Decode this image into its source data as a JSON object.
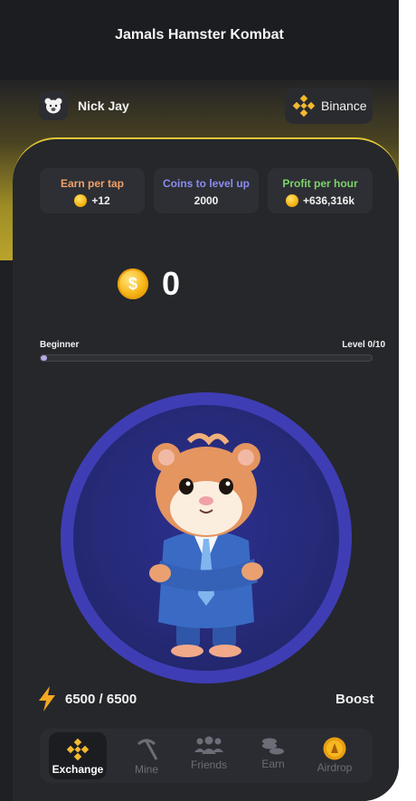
{
  "app": {
    "title": "Jamals Hamster Kombat"
  },
  "user": {
    "name": "Nick Jay",
    "avatar_icon": "hamster-face-icon"
  },
  "exchange": {
    "label": "Binance",
    "icon": "binance-logo-icon",
    "accent": "#f3ba2f"
  },
  "stats": [
    {
      "label": "Earn per tap",
      "value": "+12",
      "color": "#f0a06a"
    },
    {
      "label": "Coins to level up",
      "value": "2000",
      "color": "#8b8cf0"
    },
    {
      "label": "Profit per hour",
      "value": "+636,316k",
      "color": "#7fd36a"
    }
  ],
  "balance": {
    "value": "0",
    "coin_symbol": "$"
  },
  "level": {
    "name": "Beginner",
    "text": "Level 0/10",
    "progress": 0.02
  },
  "energy": {
    "value": "6500 / 6500",
    "icon": "lightning-icon"
  },
  "boost": {
    "label": "Boost"
  },
  "nav": [
    {
      "label": "Exchange",
      "icon": "binance-logo-icon",
      "active": true
    },
    {
      "label": "Mine",
      "icon": "pickaxe-icon",
      "active": false
    },
    {
      "label": "Friends",
      "icon": "friends-icon",
      "active": false
    },
    {
      "label": "Earn",
      "icon": "coins-stack-icon",
      "active": false
    },
    {
      "label": "Airdrop",
      "icon": "airdrop-coin-icon",
      "active": false
    }
  ]
}
